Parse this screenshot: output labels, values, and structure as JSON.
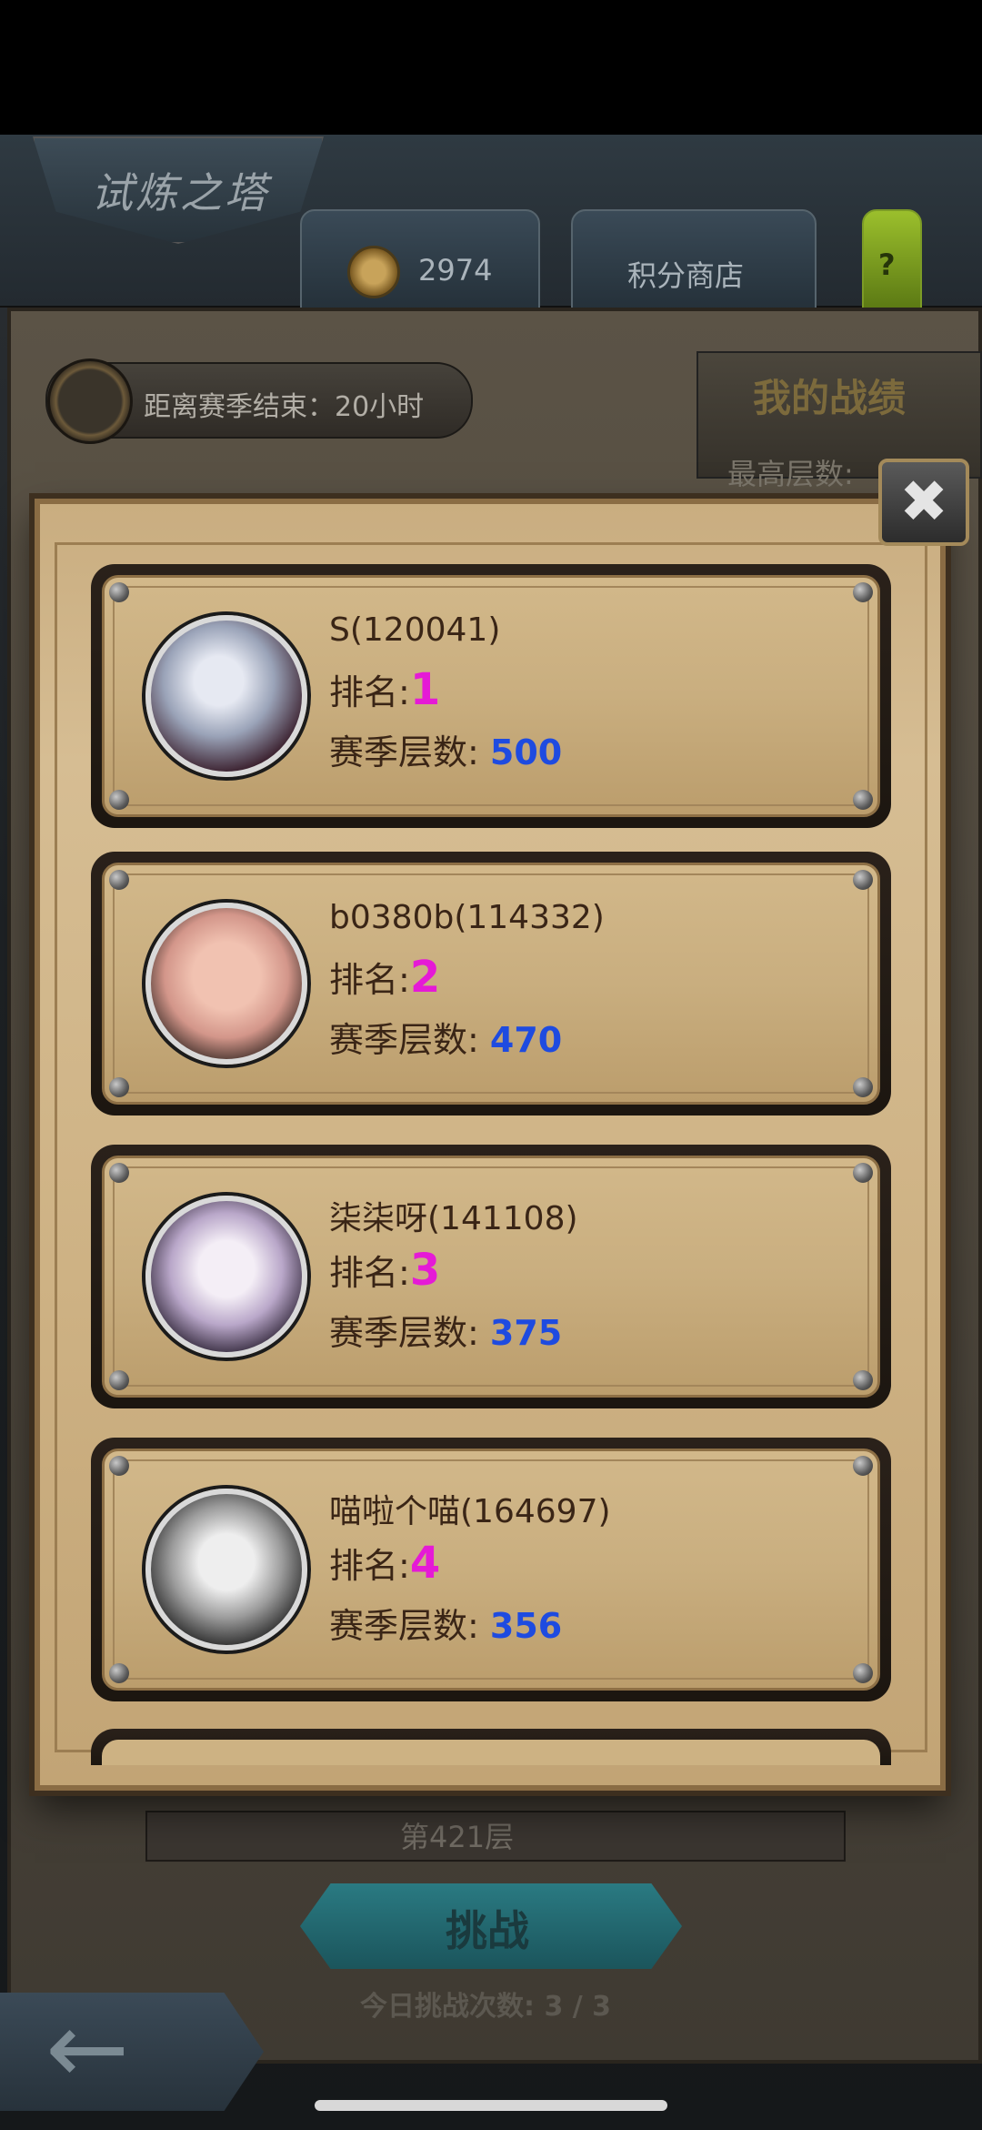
{
  "header": {
    "title": "试炼之塔",
    "score_value": "2974",
    "shop_label": "积分商店",
    "help_label": "?"
  },
  "season": {
    "countdown_text": "距离赛季结束：20小时"
  },
  "my_record": {
    "title": "我的战绩",
    "best_floor_label": "最高层数:"
  },
  "ranking_modal": {
    "close_icon": "close-icon",
    "rank_label": "排名:",
    "floor_label": "赛季层数:",
    "players": [
      {
        "name": "S(120041)",
        "rank": "1",
        "season_floors": "500"
      },
      {
        "name": "b0380b(114332)",
        "rank": "2",
        "season_floors": "470"
      },
      {
        "name": "柒柒呀(141108)",
        "rank": "3",
        "season_floors": "375"
      },
      {
        "name": "喵啦个喵(164697)",
        "rank": "4",
        "season_floors": "356"
      }
    ]
  },
  "tower": {
    "current_floor": "第421层",
    "challenge_label": "挑战",
    "attempts_text": "今日挑战次数: 3 / 3"
  },
  "colors": {
    "rank_color": "#e51ad6",
    "floor_color": "#1e4be0",
    "parchment": "#d2b88a"
  }
}
